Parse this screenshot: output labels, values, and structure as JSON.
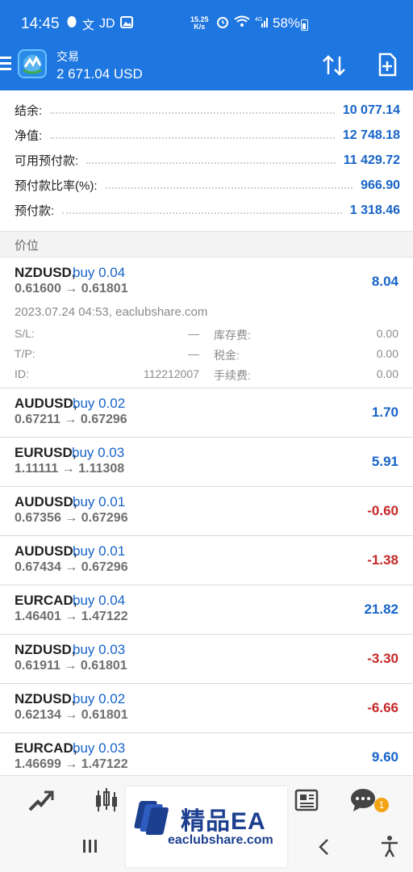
{
  "status_bar": {
    "time": "14:45",
    "carrier_text": "JD",
    "speed_value": "15.25",
    "speed_unit": "K/s",
    "network": "4G",
    "battery": "58%"
  },
  "app_bar": {
    "title": "交易",
    "balance": "2 671.04 USD"
  },
  "summary": [
    {
      "label": "结余:",
      "value": "10 077.14"
    },
    {
      "label": "净值:",
      "value": "12 748.18"
    },
    {
      "label": "可用预付款:",
      "value": "11 429.72"
    },
    {
      "label": "预付款比率(%):",
      "value": "966.90"
    },
    {
      "label": "预付款:",
      "value": "1 318.46"
    }
  ],
  "section_header": "价位",
  "positions": [
    {
      "symbol": "NZDUSD,",
      "side": "buy 0.04",
      "open": "0.61600",
      "current": "0.61801",
      "profit": "8.04",
      "negative": false
    },
    {
      "symbol": "AUDUSD,",
      "side": "buy 0.02",
      "open": "0.67211",
      "current": "0.67296",
      "profit": "1.70",
      "negative": false
    },
    {
      "symbol": "EURUSD,",
      "side": "buy 0.03",
      "open": "1.11111",
      "current": "1.11308",
      "profit": "5.91",
      "negative": false
    },
    {
      "symbol": "AUDUSD,",
      "side": "buy 0.01",
      "open": "0.67356",
      "current": "0.67296",
      "profit": "-0.60",
      "negative": true
    },
    {
      "symbol": "AUDUSD,",
      "side": "buy 0.01",
      "open": "0.67434",
      "current": "0.67296",
      "profit": "-1.38",
      "negative": true
    },
    {
      "symbol": "EURCAD,",
      "side": "buy 0.04",
      "open": "1.46401",
      "current": "1.47122",
      "profit": "21.82",
      "negative": false
    },
    {
      "symbol": "NZDUSD,",
      "side": "buy 0.03",
      "open": "0.61911",
      "current": "0.61801",
      "profit": "-3.30",
      "negative": true
    },
    {
      "symbol": "NZDUSD,",
      "side": "buy 0.02",
      "open": "0.62134",
      "current": "0.61801",
      "profit": "-6.66",
      "negative": true
    },
    {
      "symbol": "EURCAD,",
      "side": "buy 0.03",
      "open": "1.46699",
      "current": "1.47122",
      "profit": "9.60",
      "negative": false
    }
  ],
  "expanded_details": {
    "meta": "2023.07.24 04:53, eaclubshare.com",
    "sl_label": "S/L:",
    "sl_value": "—",
    "tp_label": "T/P:",
    "tp_value": "—",
    "id_label": "ID:",
    "id_value": "112212007",
    "swap_label": "库存费:",
    "swap_value": "0.00",
    "tax_label": "税金:",
    "tax_value": "0.00",
    "fee_label": "手续费:",
    "fee_value": "0.00"
  },
  "arrow": "→",
  "bottom_nav": {
    "icons": [
      "trade-chart-icon",
      "candlestick-icon",
      "newspaper-icon",
      "chat-icon"
    ],
    "chat_badge": "1"
  },
  "watermark": {
    "title": "精品EA",
    "url": "eaclubshare.com"
  },
  "colors": {
    "accent": "#1e76e0",
    "positive": "#1763c8",
    "negative": "#c62828"
  }
}
